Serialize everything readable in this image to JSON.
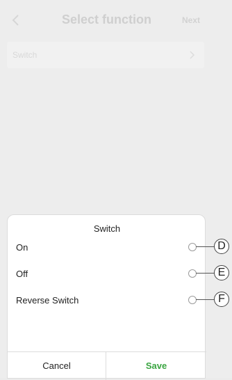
{
  "header": {
    "title": "Select function",
    "next_label": "Next"
  },
  "list": {
    "row_label": "Switch"
  },
  "sheet": {
    "title": "Switch",
    "options": [
      {
        "label": "On",
        "callout": "D"
      },
      {
        "label": "Off",
        "callout": "E"
      },
      {
        "label": "Reverse Switch",
        "callout": "F"
      }
    ],
    "cancel_label": "Cancel",
    "save_label": "Save"
  },
  "colors": {
    "save": "#3aa541",
    "radio_border": "#9b9b9b",
    "overlay": "#ededed"
  },
  "icons": {
    "back": "chevron-left-icon",
    "row": "chevron-right-icon"
  }
}
